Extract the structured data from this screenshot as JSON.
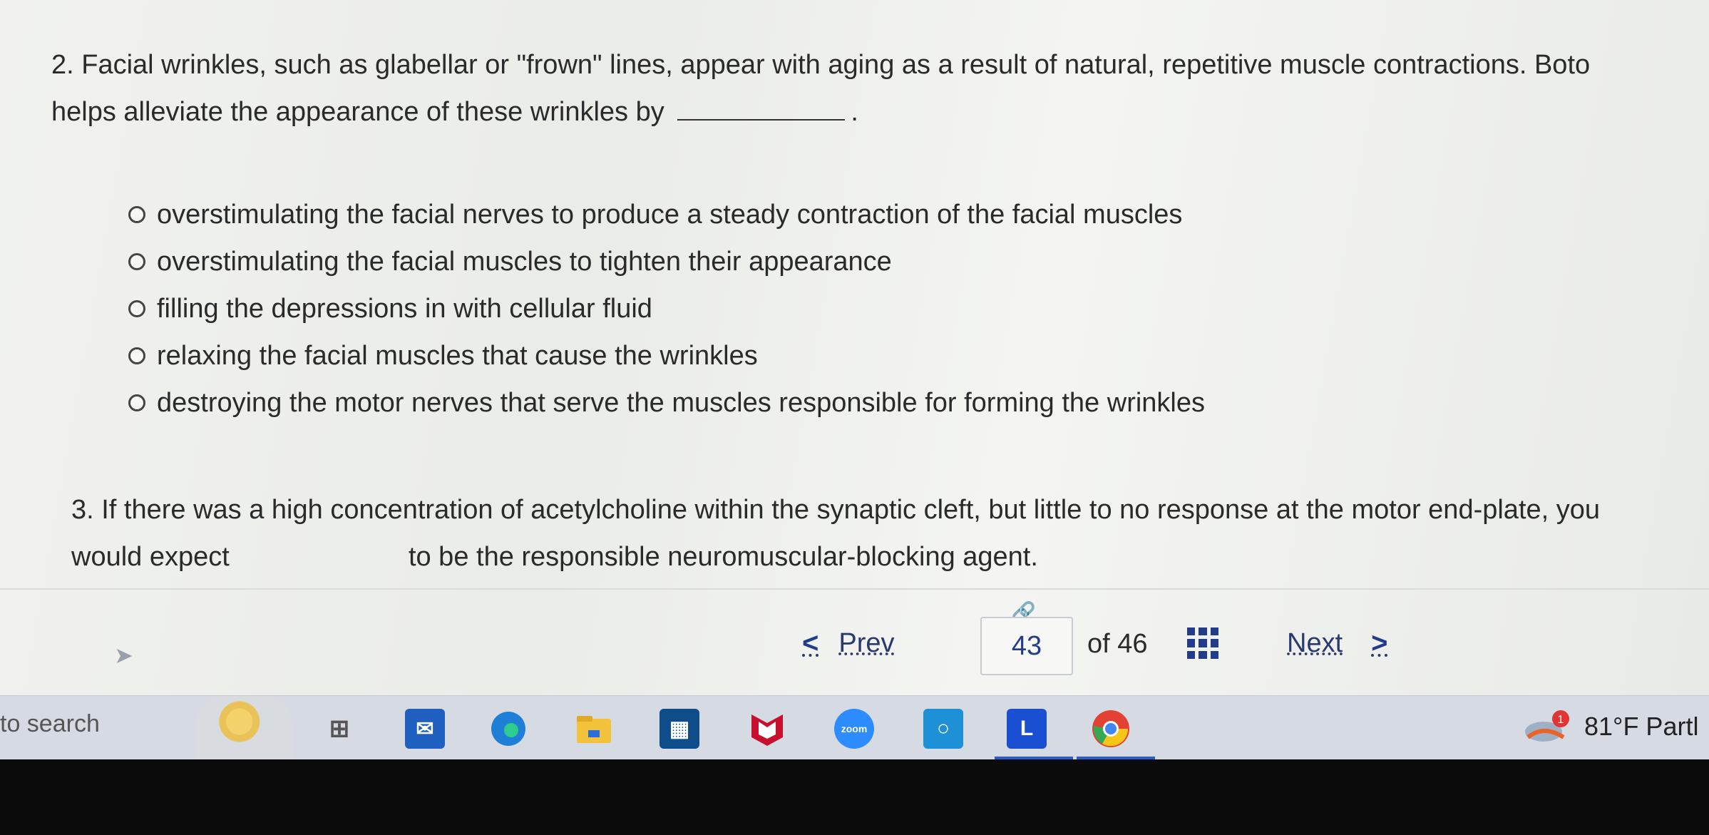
{
  "question2": {
    "text_start": "2. Facial wrinkles, such as glabellar or \"frown\" lines, appear with aging as a result of natural, repetitive muscle contractions. Boto",
    "text_end_prefix": "helps alleviate the appearance of these wrinkles by",
    "text_end_suffix": ".",
    "options": [
      "overstimulating the facial nerves to produce a steady contraction of the facial muscles",
      "overstimulating the facial muscles to tighten their appearance",
      "filling the depressions in with cellular fluid",
      "relaxing the facial muscles that cause the wrinkles",
      "destroying the motor nerves that serve the muscles responsible for forming the wrinkles"
    ]
  },
  "question3": {
    "text_start": "3. If there was a high concentration of acetylcholine within the synaptic cleft, but little to no response at the motor end-plate, you",
    "text_line2_prefix": "would expect",
    "text_line2_suffix": "to be the responsible neuromuscular-blocking agent."
  },
  "pager": {
    "prev_label": "Prev",
    "current_page": "43",
    "of_label": "of 46",
    "next_label": "Next"
  },
  "taskbar": {
    "search_text": "to search",
    "weather_badge": "1",
    "weather_text": "81°F  Partl",
    "zoom_label": "zoom",
    "l_label": "L"
  },
  "colors": {
    "accent": "#233c8a",
    "edge_blue": "#1f7fd6",
    "mcafee_red": "#c8102e",
    "store_blue": "#0f4c8a"
  }
}
